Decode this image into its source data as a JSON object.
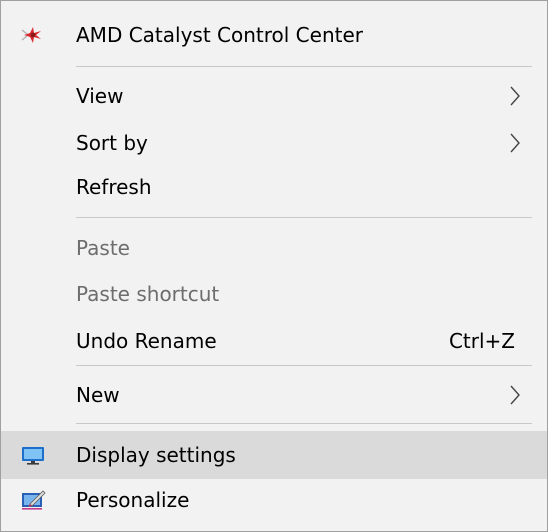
{
  "context_menu": {
    "items": [
      {
        "label": "AMD Catalyst Control Center",
        "icon": "amd-catalyst-icon"
      },
      {
        "label": "View",
        "submenu": true
      },
      {
        "label": "Sort by",
        "submenu": true
      },
      {
        "label": "Refresh"
      },
      {
        "label": "Paste",
        "disabled": true
      },
      {
        "label": "Paste shortcut",
        "disabled": true
      },
      {
        "label": "Undo Rename",
        "shortcut": "Ctrl+Z"
      },
      {
        "label": "New",
        "submenu": true
      },
      {
        "label": "Display settings",
        "icon": "display-settings-icon",
        "highlighted": true
      },
      {
        "label": "Personalize",
        "icon": "personalize-icon"
      }
    ]
  },
  "colors": {
    "menu_background": "#f2f2f2",
    "highlight": "#dadada",
    "disabled_text": "#6d6d6d",
    "separator": "#c8c8c8"
  }
}
